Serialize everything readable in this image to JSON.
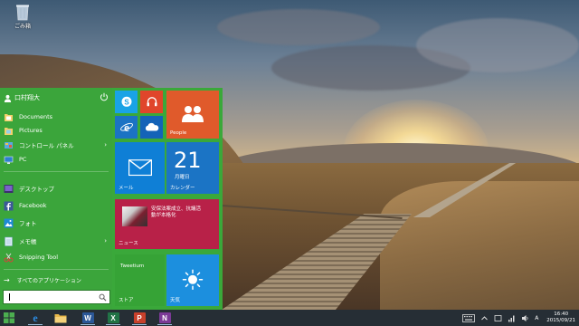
{
  "desktop": {
    "recycle_bin_label": "ごみ箱"
  },
  "start_menu": {
    "user_name": "口村翔大",
    "items": [
      {
        "label": "Documents",
        "icon": "folder-documents-icon"
      },
      {
        "label": "Pictures",
        "icon": "folder-pictures-icon"
      },
      {
        "label": "コントロール パネル",
        "icon": "control-panel-icon",
        "has_submenu": true
      },
      {
        "label": "PC",
        "icon": "pc-icon"
      },
      {
        "label": "デスクトップ",
        "icon": "desktop-icon"
      },
      {
        "label": "Facebook",
        "icon": "facebook-icon"
      },
      {
        "label": "フォト",
        "icon": "photos-icon"
      },
      {
        "label": "メモ帳",
        "icon": "notepad-icon",
        "has_submenu": true
      },
      {
        "label": "Snipping Tool",
        "icon": "snipping-tool-icon"
      }
    ],
    "all_apps_label": "すべてのアプリケーション",
    "chevron": "›",
    "arrow": "→",
    "search_value": ""
  },
  "tiles": {
    "people": {
      "label": "People",
      "color": "#e05a2b"
    },
    "mail": {
      "label": "メール",
      "color": "#0f7fd6"
    },
    "calendar": {
      "label": "カレンダー",
      "date": "21",
      "day": "月曜日",
      "color": "#1b74c5"
    },
    "news": {
      "label": "ニュース",
      "headline": "安保法案成立、抗議活動が本格化",
      "color": "#b82148"
    },
    "store": {
      "label": "ストア",
      "app": "Tweetium",
      "color": "#36a336"
    },
    "weather": {
      "label": "天気",
      "color": "#1c8fde"
    },
    "skype": {
      "color": "#19a3e6"
    },
    "music": {
      "color": "#e0452b"
    },
    "ie": {
      "color": "#1b73c4"
    },
    "onedrive": {
      "color": "#1463b8"
    }
  },
  "taskbar": {
    "apps": [
      {
        "name": "internet-explorer",
        "letter": "e",
        "color": "#2c8be0"
      },
      {
        "name": "file-explorer",
        "letter": "",
        "color": "#e8b94a"
      },
      {
        "name": "word",
        "letter": "W",
        "color": "#2b5797"
      },
      {
        "name": "excel",
        "letter": "X",
        "color": "#217346"
      },
      {
        "name": "powerpoint",
        "letter": "P",
        "color": "#c7402b"
      },
      {
        "name": "onenote",
        "letter": "N",
        "color": "#7b3a96"
      }
    ],
    "time": "16:40",
    "date": "2015/09/21",
    "ime": "A"
  }
}
